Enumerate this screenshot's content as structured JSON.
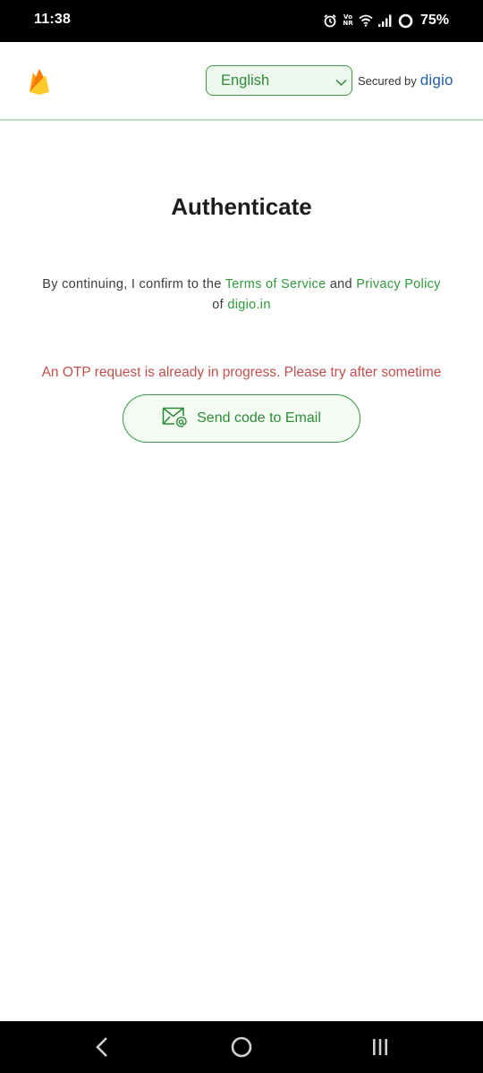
{
  "status_bar": {
    "time": "11:38",
    "volte_top": "Vo",
    "volte_bottom": "NR",
    "battery": "75%",
    "icons": [
      "alarm-icon",
      "volte-icon",
      "wifi-icon",
      "signal-icon",
      "battery-ring-icon"
    ]
  },
  "header": {
    "logo": "firebase-flame-icon",
    "language": "English",
    "secured_label": "Secured by",
    "brand": "digio"
  },
  "main": {
    "title": "Authenticate",
    "consent_prefix": "By continuing, I confirm to the",
    "terms_link": "Terms of Service",
    "and": "and",
    "privacy_link": "Privacy Policy",
    "of": "of",
    "site_link": "digio.in",
    "error": "An OTP request is already in progress. Please try after sometime",
    "email_button": "Send code to Email"
  },
  "colors": {
    "accent": "#2e8b38",
    "error": "#c0504d",
    "brand": "#1e5fa8"
  },
  "nav_bar": {
    "buttons": [
      "back-icon",
      "home-icon",
      "recents-icon"
    ]
  }
}
